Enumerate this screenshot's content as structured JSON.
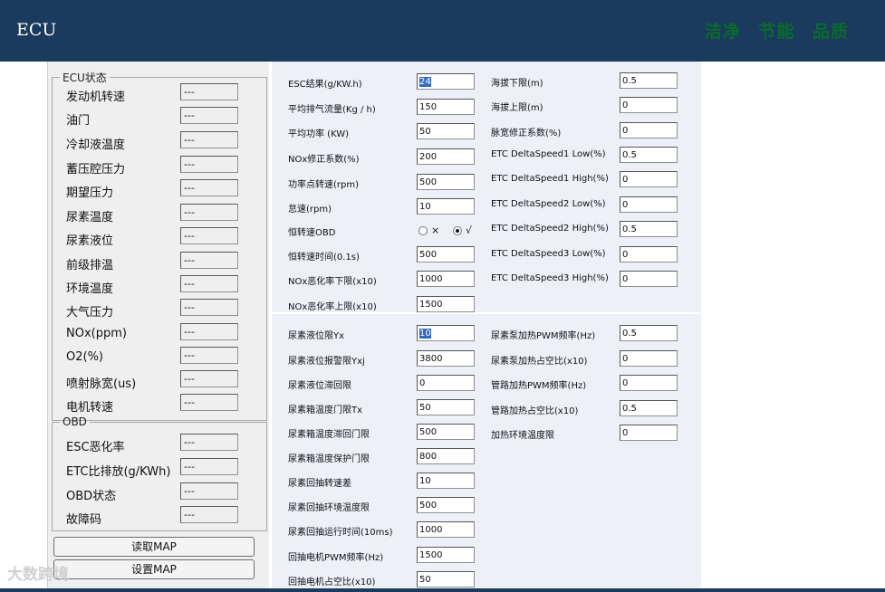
{
  "header": {
    "title": "ECU",
    "slogan": [
      "洁净",
      "节能",
      "品质"
    ]
  },
  "ecu_status": {
    "legend": "ECU状态",
    "items": [
      {
        "label": "发动机转速",
        "value": "---"
      },
      {
        "label": "油门",
        "value": "---"
      },
      {
        "label": "冷却液温度",
        "value": "---"
      },
      {
        "label": "蓄压腔压力",
        "value": "---"
      },
      {
        "label": "期望压力",
        "value": "---"
      },
      {
        "label": "尿素温度",
        "value": "---"
      },
      {
        "label": "尿素液位",
        "value": "---"
      },
      {
        "label": "前级排温",
        "value": "---"
      },
      {
        "label": "环境温度",
        "value": "---"
      },
      {
        "label": "大气压力",
        "value": "---"
      },
      {
        "label": "NOx(ppm)",
        "value": "---"
      },
      {
        "label": "O2(%)",
        "value": "---"
      },
      {
        "label": "喷射脉宽(us)",
        "value": "---"
      },
      {
        "label": "电机转速",
        "value": "---"
      }
    ]
  },
  "obd": {
    "legend": "OBD",
    "items": [
      {
        "label": "ESC恶化率",
        "value": "---"
      },
      {
        "label": "ETC比排放(g/KWh)",
        "value": "---"
      },
      {
        "label": "OBD状态",
        "value": "---"
      },
      {
        "label": "故障码",
        "value": "---"
      }
    ]
  },
  "buttons": {
    "read_map": "读取MAP",
    "set_map": "设置MAP"
  },
  "watermark": "大数跨境",
  "top_left_params": [
    {
      "label": "ESC结果(g/KW.h)",
      "value": "24",
      "selected": true
    },
    {
      "label": "平均排气流量(Kg / h)",
      "value": "150"
    },
    {
      "label": "平均功率 (KW)",
      "value": "50"
    },
    {
      "label": "NOx修正系数(%)",
      "value": "200"
    },
    {
      "label": "功率点转速(rpm)",
      "value": "500"
    },
    {
      "label": "怠速(rpm)",
      "value": "10"
    },
    {
      "label": "恒转速OBD",
      "radio": true
    },
    {
      "label": "恒转速时间(0.1s)",
      "value": "500"
    },
    {
      "label": "NOx恶化率下限(x10)",
      "value": "1000"
    },
    {
      "label": "NOx恶化率上限(x10)",
      "value": "1500"
    }
  ],
  "radio": {
    "option_no": "×",
    "option_yes": "√"
  },
  "top_right_params": [
    {
      "label": "海拔下限(m)",
      "value": "0.5"
    },
    {
      "label": "海拔上限(m)",
      "value": "0"
    },
    {
      "label": "脉宽修正系数(%)",
      "value": "0"
    },
    {
      "label": "ETC DeltaSpeed1 Low(%)",
      "value": "0.5"
    },
    {
      "label": "ETC DeltaSpeed1 High(%)",
      "value": "0"
    },
    {
      "label": "ETC DeltaSpeed2 Low(%)",
      "value": "0"
    },
    {
      "label": "ETC DeltaSpeed2 High(%)",
      "value": "0.5"
    },
    {
      "label": "ETC DeltaSpeed3 Low(%)",
      "value": "0"
    },
    {
      "label": "ETC DeltaSpeed3 High(%)",
      "value": "0"
    }
  ],
  "bottom_left_params": [
    {
      "label": "尿素液位限Yx",
      "value": "10",
      "selected": true
    },
    {
      "label": "尿素液位报警限Yxj",
      "value": "3800"
    },
    {
      "label": "尿素液位滞回限",
      "value": "0"
    },
    {
      "label": "尿素箱温度门限Tx",
      "value": "50"
    },
    {
      "label": "尿素箱温度滞回门限",
      "value": "500"
    },
    {
      "label": "尿素箱温度保护门限",
      "value": "800"
    },
    {
      "label": "尿素回抽转速差",
      "value": "10"
    },
    {
      "label": "尿素回抽环境温度限",
      "value": "500"
    },
    {
      "label": "尿素回抽运行时间(10ms)",
      "value": "1000"
    },
    {
      "label": "回抽电机PWM频率(Hz)",
      "value": "1500"
    },
    {
      "label": "回抽电机占空比(x10)",
      "value": "50"
    }
  ],
  "bottom_right_params": [
    {
      "label": "尿素泵加热PWM频率(Hz)",
      "value": "0.5"
    },
    {
      "label": "尿素泵加热占空比(x10)",
      "value": "0"
    },
    {
      "label": "管路加热PWM频率(Hz)",
      "value": "0"
    },
    {
      "label": "管路加热占空比(x10)",
      "value": "0.5"
    },
    {
      "label": "加热环境温度限",
      "value": "0"
    }
  ]
}
